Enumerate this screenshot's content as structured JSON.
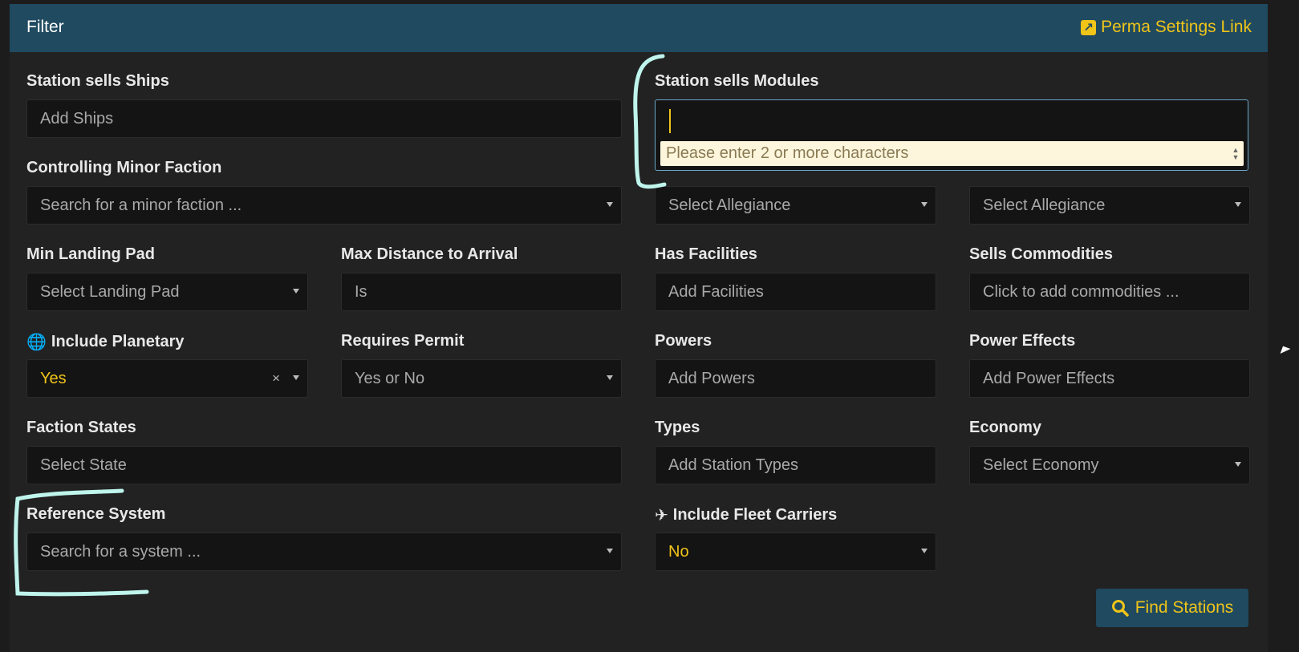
{
  "header": {
    "title": "Filter",
    "perma_link_label": "Perma Settings Link"
  },
  "fields": {
    "station_sells_ships": {
      "label": "Station sells Ships",
      "placeholder": "Add Ships"
    },
    "station_sells_modules": {
      "label": "Station sells Modules",
      "value": "",
      "hint": "Please enter 2 or more characters"
    },
    "controlling_minor_faction": {
      "label": "Controlling Minor Faction",
      "placeholder": "Search for a minor faction ..."
    },
    "allegiance": {
      "placeholder": "Select Allegiance"
    },
    "government": {
      "placeholder": "Select Allegiance"
    },
    "min_landing_pad": {
      "label": "Min Landing Pad",
      "placeholder": "Select Landing Pad"
    },
    "max_distance_to_arrival": {
      "label": "Max Distance to Arrival",
      "value": "Is"
    },
    "has_facilities": {
      "label": "Has Facilities",
      "placeholder": "Add Facilities"
    },
    "sells_commodities": {
      "label": "Sells Commodities",
      "placeholder": "Click to add commodities ..."
    },
    "include_planetary": {
      "label": "Include Planetary",
      "value": "Yes",
      "clear_glyph": "×"
    },
    "requires_permit": {
      "label": "Requires Permit",
      "placeholder": "Yes or No"
    },
    "powers": {
      "label": "Powers",
      "placeholder": "Add Powers"
    },
    "power_effects": {
      "label": "Power Effects",
      "placeholder": "Add Power Effects"
    },
    "faction_states": {
      "label": "Faction States",
      "placeholder": "Select State"
    },
    "types": {
      "label": "Types",
      "placeholder": "Add Station Types"
    },
    "economy": {
      "label": "Economy",
      "placeholder": "Select Economy"
    },
    "reference_system": {
      "label": "Reference System",
      "placeholder": "Search for a system ..."
    },
    "include_fleet_carriers": {
      "label": "Include Fleet Carriers",
      "value": "No"
    }
  },
  "find_button_label": "Find Stations",
  "icons": {
    "perma_link": "external-link-icon",
    "include_planetary": "globe-icon",
    "include_fleet_carriers": "fleet-carrier-icon",
    "find": "search-icon"
  },
  "colors": {
    "header_bg": "#1f4a60",
    "accent": "#f0c419",
    "panel_bg": "#222222",
    "input_bg": "#141414",
    "annotation": "#bff5ec"
  }
}
